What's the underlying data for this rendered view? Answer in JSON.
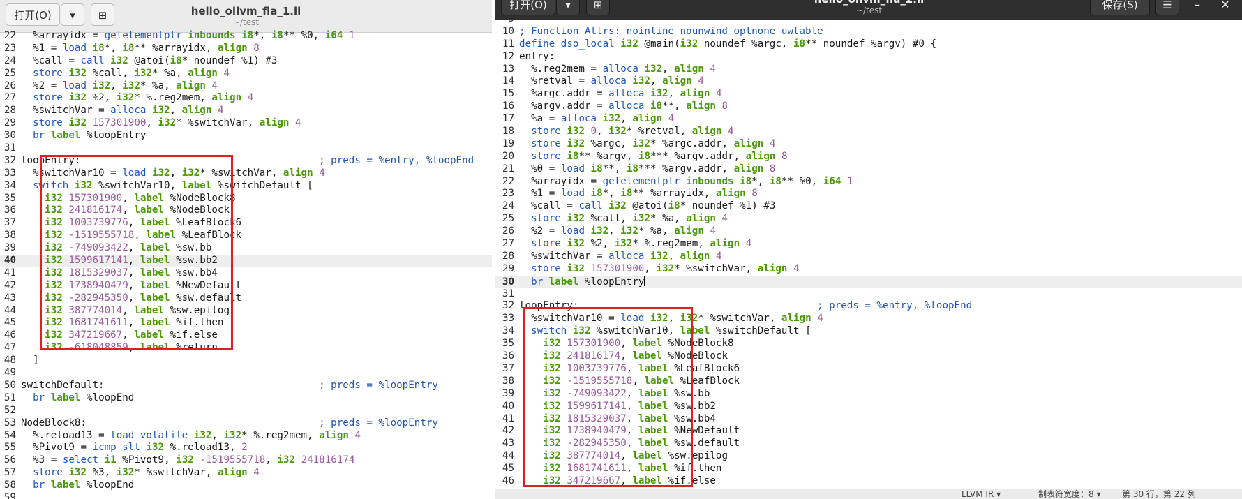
{
  "colors": {
    "keyword": "#1f58b8",
    "type": "#4a9a06",
    "number": "#9a5a9a",
    "comment": "#2055b0",
    "highlight_box": "#e02020"
  },
  "left_window": {
    "open_button": "打开(O)",
    "title": "hello_ollvm_fla_1.ll",
    "subtitle": "~/test",
    "icons": {
      "open_menu": "chevron-down-icon",
      "new_document": "new-document-icon"
    },
    "current_line": 40,
    "lines": [
      {
        "n": 22,
        "t": "  %arrayidx = getelementptr inbounds i8*, i8** %0, i64 1"
      },
      {
        "n": 23,
        "t": "  %1 = load i8*, i8** %arrayidx, align 8"
      },
      {
        "n": 24,
        "t": "  %call = call i32 @atoi(i8* noundef %1) #3"
      },
      {
        "n": 25,
        "t": "  store i32 %call, i32* %a, align 4"
      },
      {
        "n": 26,
        "t": "  %2 = load i32, i32* %a, align 4"
      },
      {
        "n": 27,
        "t": "  store i32 %2, i32* %.reg2mem, align 4"
      },
      {
        "n": 28,
        "t": "  %switchVar = alloca i32, align 4"
      },
      {
        "n": 29,
        "t": "  store i32 157301900, i32* %switchVar, align 4"
      },
      {
        "n": 30,
        "t": "  br label %loopEntry"
      },
      {
        "n": 31,
        "t": ""
      },
      {
        "n": 32,
        "t": "loopEntry:                                        ; preds = %entry, %loopEnd"
      },
      {
        "n": 33,
        "t": "  %switchVar10 = load i32, i32* %switchVar, align 4"
      },
      {
        "n": 34,
        "t": "  switch i32 %switchVar10, label %switchDefault ["
      },
      {
        "n": 35,
        "t": "    i32 157301900, label %NodeBlock8"
      },
      {
        "n": 36,
        "t": "    i32 241816174, label %NodeBlock"
      },
      {
        "n": 37,
        "t": "    i32 1003739776, label %LeafBlock6"
      },
      {
        "n": 38,
        "t": "    i32 -1519555718, label %LeafBlock"
      },
      {
        "n": 39,
        "t": "    i32 -749093422, label %sw.bb"
      },
      {
        "n": 40,
        "t": "    i32 1599617141, label %sw.bb2"
      },
      {
        "n": 41,
        "t": "    i32 1815329037, label %sw.bb4"
      },
      {
        "n": 42,
        "t": "    i32 1738940479, label %NewDefault"
      },
      {
        "n": 43,
        "t": "    i32 -282945350, label %sw.default"
      },
      {
        "n": 44,
        "t": "    i32 387774014, label %sw.epilog"
      },
      {
        "n": 45,
        "t": "    i32 1681741611, label %if.then"
      },
      {
        "n": 46,
        "t": "    i32 347219667, label %if.else"
      },
      {
        "n": 47,
        "t": "    i32 -618048859, label %return"
      },
      {
        "n": 48,
        "t": "  ]"
      },
      {
        "n": 49,
        "t": ""
      },
      {
        "n": 50,
        "t": "switchDefault:                                    ; preds = %loopEntry"
      },
      {
        "n": 51,
        "t": "  br label %loopEnd"
      },
      {
        "n": 52,
        "t": ""
      },
      {
        "n": 53,
        "t": "NodeBlock8:                                       ; preds = %loopEntry"
      },
      {
        "n": 54,
        "t": "  %.reload13 = load volatile i32, i32* %.reg2mem, align 4"
      },
      {
        "n": 55,
        "t": "  %Pivot9 = icmp slt i32 %.reload13, 2"
      },
      {
        "n": 56,
        "t": "  %3 = select i1 %Pivot9, i32 -1519555718, i32 241816174"
      },
      {
        "n": 57,
        "t": "  store i32 %3, i32* %switchVar, align 4"
      },
      {
        "n": 58,
        "t": "  br label %loopEnd"
      },
      {
        "n": 59,
        "t": ""
      }
    ]
  },
  "right_window": {
    "open_button": "打开(O)",
    "title": "hello_ollvm_fla_2.ll",
    "subtitle": "~/test",
    "save_button": "保存(S)",
    "icons": {
      "open_menu": "chevron-down-icon",
      "new_document": "new-document-icon",
      "menu": "hamburger-menu-icon",
      "minimize": "minimize-icon",
      "close": "close-icon"
    },
    "current_line": 30,
    "lines": [
      {
        "n": 9,
        "t": ""
      },
      {
        "n": 10,
        "t": "; Function Attrs: noinline nounwind optnone uwtable"
      },
      {
        "n": 11,
        "t": "define dso_local i32 @main(i32 noundef %argc, i8** noundef %argv) #0 {"
      },
      {
        "n": 12,
        "t": "entry:"
      },
      {
        "n": 13,
        "t": "  %.reg2mem = alloca i32, align 4"
      },
      {
        "n": 14,
        "t": "  %retval = alloca i32, align 4"
      },
      {
        "n": 15,
        "t": "  %argc.addr = alloca i32, align 4"
      },
      {
        "n": 16,
        "t": "  %argv.addr = alloca i8**, align 8"
      },
      {
        "n": 17,
        "t": "  %a = alloca i32, align 4"
      },
      {
        "n": 18,
        "t": "  store i32 0, i32* %retval, align 4"
      },
      {
        "n": 19,
        "t": "  store i32 %argc, i32* %argc.addr, align 4"
      },
      {
        "n": 20,
        "t": "  store i8** %argv, i8*** %argv.addr, align 8"
      },
      {
        "n": 21,
        "t": "  %0 = load i8**, i8*** %argv.addr, align 8"
      },
      {
        "n": 22,
        "t": "  %arrayidx = getelementptr inbounds i8*, i8** %0, i64 1"
      },
      {
        "n": 23,
        "t": "  %1 = load i8*, i8** %arrayidx, align 8"
      },
      {
        "n": 24,
        "t": "  %call = call i32 @atoi(i8* noundef %1) #3"
      },
      {
        "n": 25,
        "t": "  store i32 %call, i32* %a, align 4"
      },
      {
        "n": 26,
        "t": "  %2 = load i32, i32* %a, align 4"
      },
      {
        "n": 27,
        "t": "  store i32 %2, i32* %.reg2mem, align 4"
      },
      {
        "n": 28,
        "t": "  %switchVar = alloca i32, align 4"
      },
      {
        "n": 29,
        "t": "  store i32 157301900, i32* %switchVar, align 4"
      },
      {
        "n": 30,
        "t": "  br label %loopEntry"
      },
      {
        "n": 31,
        "t": ""
      },
      {
        "n": 32,
        "t": "loopEntry:                                        ; preds = %entry, %loopEnd"
      },
      {
        "n": 33,
        "t": "  %switchVar10 = load i32, i32* %switchVar, align 4"
      },
      {
        "n": 34,
        "t": "  switch i32 %switchVar10, label %switchDefault ["
      },
      {
        "n": 35,
        "t": "    i32 157301900, label %NodeBlock8"
      },
      {
        "n": 36,
        "t": "    i32 241816174, label %NodeBlock"
      },
      {
        "n": 37,
        "t": "    i32 1003739776, label %LeafBlock6"
      },
      {
        "n": 38,
        "t": "    i32 -1519555718, label %LeafBlock"
      },
      {
        "n": 39,
        "t": "    i32 -749093422, label %sw.bb"
      },
      {
        "n": 40,
        "t": "    i32 1599617141, label %sw.bb2"
      },
      {
        "n": 41,
        "t": "    i32 1815329037, label %sw.bb4"
      },
      {
        "n": 42,
        "t": "    i32 1738940479, label %NewDefault"
      },
      {
        "n": 43,
        "t": "    i32 -282945350, label %sw.default"
      },
      {
        "n": 44,
        "t": "    i32 387774014, label %sw.epilog"
      },
      {
        "n": 45,
        "t": "    i32 1681741611, label %if.then"
      },
      {
        "n": 46,
        "t": "    i32 347219667, label %if.else"
      }
    ],
    "statusbar": {
      "language": "LLVM IR ▾",
      "tab_width": "制表符宽度：8 ▾",
      "position": "第 30 行，第 22 列"
    }
  }
}
